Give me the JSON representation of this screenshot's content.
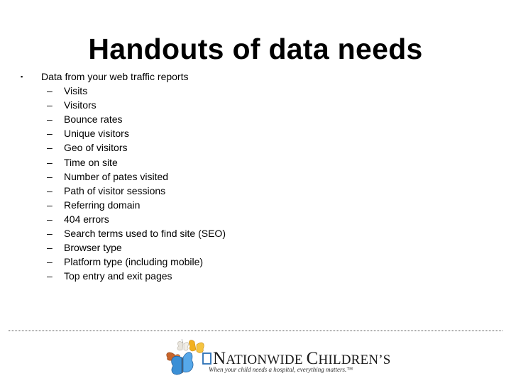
{
  "slide": {
    "title": "Handouts of data needs",
    "bullet": {
      "marker": "▪",
      "text": "Data from your web traffic reports"
    },
    "subitems": [
      {
        "dash": "–",
        "text": "Visits"
      },
      {
        "dash": "–",
        "text": "Visitors"
      },
      {
        "dash": "–",
        "text": "Bounce rates"
      },
      {
        "dash": "–",
        "text": "Unique visitors"
      },
      {
        "dash": "–",
        "text": "Geo of visitors"
      },
      {
        "dash": "–",
        "text": "Time on site"
      },
      {
        "dash": "–",
        "text": "Number of pates visited"
      },
      {
        "dash": "–",
        "text": "Path of visitor sessions"
      },
      {
        "dash": "–",
        "text": "Referring domain"
      },
      {
        "dash": "–",
        "text": "404 errors"
      },
      {
        "dash": "–",
        "text": "Search terms used to find site (SEO)"
      },
      {
        "dash": "–",
        "text": "Browser type"
      },
      {
        "dash": "–",
        "text": "Platform type (including mobile)"
      },
      {
        "dash": "–",
        "text": "Top entry and exit pages"
      }
    ]
  },
  "footer": {
    "logo": {
      "icon": "butterflies-icon",
      "name_first_initial": "N",
      "name_first_rest": "ATIONWIDE",
      "name_second_initial": "C",
      "name_second_rest": "HILDREN’S",
      "tagline": "When your child needs a hospital, everything matters.™",
      "colors": {
        "blue_butterfly": "#3a8fd6",
        "yellow_butterfly": "#f2b01e",
        "orange_butterfly": "#c8642a",
        "white_butterfly": "#e8e4dc",
        "square_outline": "#2a6fb5"
      }
    }
  }
}
